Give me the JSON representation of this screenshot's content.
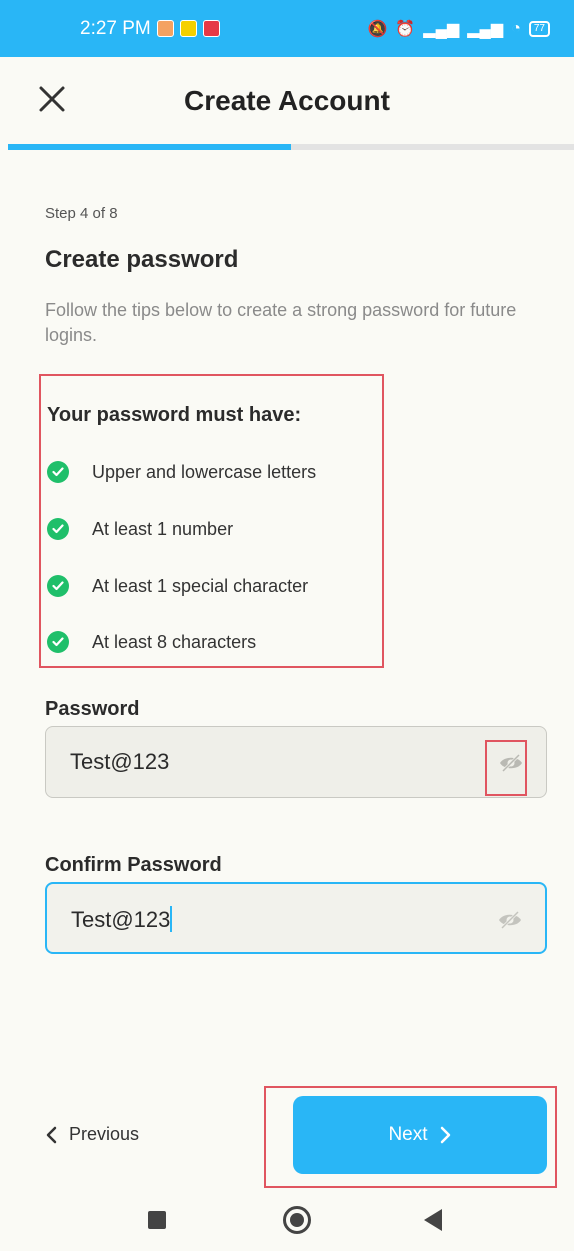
{
  "status_bar": {
    "time": "2:27 PM",
    "battery": "77",
    "colors": {
      "background": "#29b6f6"
    }
  },
  "header": {
    "title": "Create Account",
    "close_icon": "close-icon",
    "progress_fraction": 0.5
  },
  "step": {
    "label": "Step 4 of 8"
  },
  "page": {
    "title": "Create password",
    "description": "Follow the tips below to create a strong password for future logins."
  },
  "requirements": {
    "title": "Your password must have:",
    "items": [
      {
        "label": "Upper and lowercase letters",
        "met": true
      },
      {
        "label": "At least 1 number",
        "met": true
      },
      {
        "label": "At least 1 special character",
        "met": true
      },
      {
        "label": "At least 8 characters",
        "met": true
      }
    ]
  },
  "password_field": {
    "label": "Password",
    "value": "Test@123",
    "toggle_icon": "eye-slash-icon"
  },
  "confirm_field": {
    "label": "Confirm Password",
    "value": "Test@123",
    "toggle_icon": "eye-slash-icon"
  },
  "footer": {
    "previous_label": "Previous",
    "next_label": "Next"
  },
  "colors": {
    "accent": "#29b6f6",
    "success": "#1fbf6a",
    "highlight": "#e05560"
  }
}
